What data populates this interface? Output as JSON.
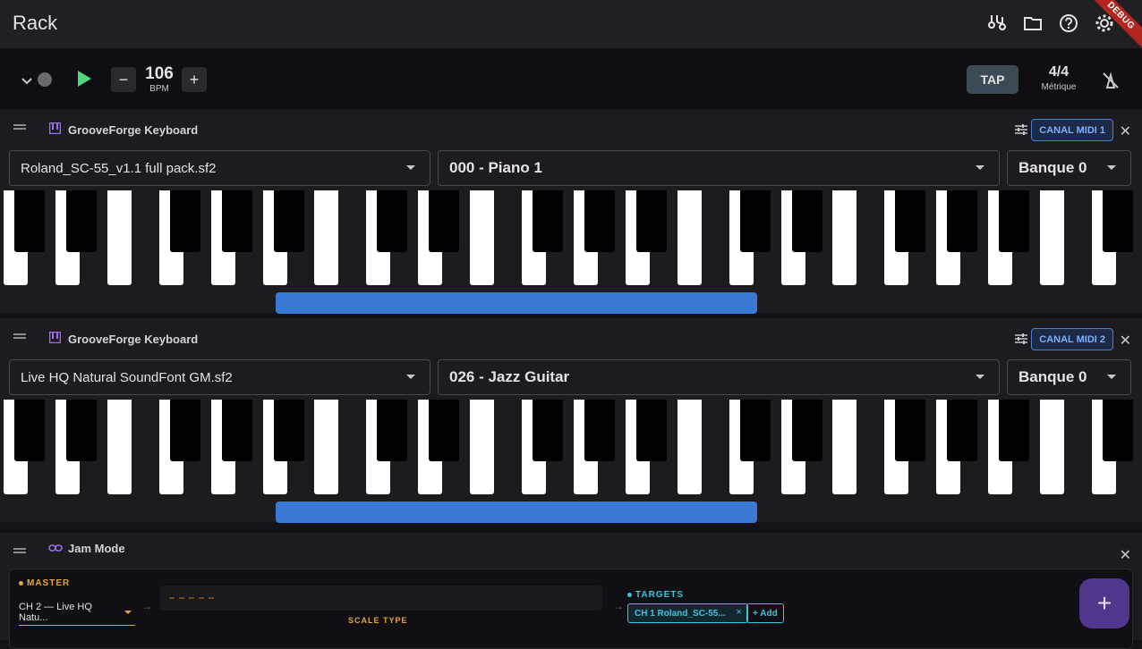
{
  "app": {
    "title": "Rack",
    "debug_banner": "DEBUG"
  },
  "appbar_icons": [
    "midi-cable-icon",
    "folder-icon",
    "help-icon",
    "settings-icon"
  ],
  "transport": {
    "bpm_value": "106",
    "bpm_label": "BPM",
    "minus": "−",
    "plus": "+",
    "tap_label": "TAP",
    "meter_value": "4/4",
    "meter_label": "Métrique"
  },
  "panels": [
    {
      "name": "GrooveForge Keyboard",
      "channel": "CANAL MIDI 1",
      "soundfont": "Roland_SC-55_v1.1 full pack.sf2",
      "patch": "000 - Piano 1",
      "bank": "Banque 0"
    },
    {
      "name": "GrooveForge Keyboard",
      "channel": "CANAL MIDI 2",
      "soundfont": "Live HQ Natural SoundFont GM.sf2",
      "patch": "026 - Jazz Guitar",
      "bank": "Banque 0"
    }
  ],
  "jam": {
    "name": "Jam Mode",
    "master_label": "MASTER",
    "master_value_line1": "CH 2 — Live HQ",
    "master_value_line2": "Natu...",
    "scale_type_label": "SCALE TYPE",
    "targets_label": "TARGETS",
    "target_chip": "CH 1 Roland_SC-55...",
    "add_label": "+ Add"
  },
  "fab_label": "+",
  "colors": {
    "accent_green": "#4fd47a",
    "chip_blue": "#7fb0ff",
    "master_orange": "#e8a33a",
    "targets_cyan": "#3cc4e0",
    "fab": "#4f378b"
  }
}
